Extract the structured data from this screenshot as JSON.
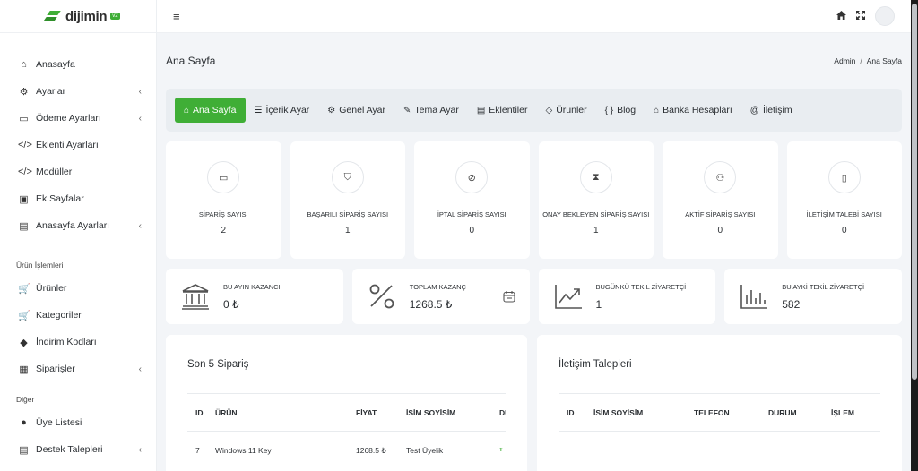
{
  "brand": {
    "name": "dijimin",
    "version": "v2",
    "accent": "#3fae36"
  },
  "sidebar": {
    "items": [
      {
        "label": "Anasayfa",
        "icon": "home-icon",
        "glyph": "⌂",
        "chevron": false
      },
      {
        "label": "Ayarlar",
        "icon": "cogs-icon",
        "glyph": "⚙",
        "chevron": true
      },
      {
        "label": "Ödeme Ayarları",
        "icon": "credit-card-icon",
        "glyph": "▭",
        "chevron": true
      },
      {
        "label": "Eklenti Ayarları",
        "icon": "code-icon",
        "glyph": "</>",
        "chevron": false
      },
      {
        "label": "Modüller",
        "icon": "code-icon",
        "glyph": "</>",
        "chevron": false
      },
      {
        "label": "Ek Sayfalar",
        "icon": "user-page-icon",
        "glyph": "▣",
        "chevron": false
      },
      {
        "label": "Anasayfa Ayarları",
        "icon": "id-card-icon",
        "glyph": "▤",
        "chevron": true
      }
    ],
    "section1": "Ürün İşlemleri",
    "items2": [
      {
        "label": "Ürünler",
        "icon": "cart-icon",
        "glyph": "🛒",
        "chevron": false
      },
      {
        "label": "Kategoriler",
        "icon": "cart-icon",
        "glyph": "🛒",
        "chevron": false
      },
      {
        "label": "İndirim Kodları",
        "icon": "tag-icon",
        "glyph": "◆",
        "chevron": false
      },
      {
        "label": "Siparişler",
        "icon": "briefcase-icon",
        "glyph": "▦",
        "chevron": true
      }
    ],
    "section2": "Diğer",
    "items3": [
      {
        "label": "Üye Listesi",
        "icon": "user-icon",
        "glyph": "●",
        "chevron": false
      },
      {
        "label": "Destek Talepleri",
        "icon": "id-card-icon",
        "glyph": "▤",
        "chevron": true
      }
    ]
  },
  "topbar": {
    "menu_glyph": "≡",
    "home_glyph": "⌂",
    "expand_glyph": "⤢"
  },
  "page": {
    "title": "Ana Sayfa",
    "breadcrumb": [
      "Admin",
      "Ana Sayfa"
    ]
  },
  "tabs": [
    {
      "label": "Ana Sayfa",
      "glyph": "⌂",
      "icon": "home-outline-icon",
      "active": true
    },
    {
      "label": "İçerik Ayar",
      "glyph": "☰",
      "icon": "list-icon",
      "active": false
    },
    {
      "label": "Genel Ayar",
      "glyph": "⚙",
      "icon": "gear-icon",
      "active": false
    },
    {
      "label": "Tema Ayar",
      "glyph": "✎",
      "icon": "magic-wand-icon",
      "active": false
    },
    {
      "label": "Eklentiler",
      "glyph": "▤",
      "icon": "layout-icon",
      "active": false
    },
    {
      "label": "Ürünler",
      "glyph": "◇",
      "icon": "tag-outline-icon",
      "active": false
    },
    {
      "label": "Blog",
      "glyph": "{ }",
      "icon": "braces-icon",
      "active": false
    },
    {
      "label": "Banka Hesapları",
      "glyph": "⌂",
      "icon": "bank-icon",
      "active": false
    },
    {
      "label": "İletişim",
      "glyph": "@",
      "icon": "at-icon",
      "active": false
    }
  ],
  "stats": [
    {
      "label": "SİPARİŞ SAYISI",
      "value": "2",
      "icon": "archive-icon",
      "glyph": "▭"
    },
    {
      "label": "BAŞARILI SİPARİŞ SAYISI",
      "value": "1",
      "icon": "shield-plus-icon",
      "glyph": "⛉"
    },
    {
      "label": "İPTAL SİPARİŞ SAYISI",
      "value": "0",
      "icon": "ban-icon",
      "glyph": "⊘"
    },
    {
      "label": "ONAY BEKLEYEN SİPARİŞ SAYISI",
      "value": "1",
      "icon": "hourglass-icon",
      "glyph": "⧗"
    },
    {
      "label": "AKTİF SİPARİŞ SAYISI",
      "value": "0",
      "icon": "user-clock-icon",
      "glyph": "⚇"
    },
    {
      "label": "İLETİŞİM TALEBİ SAYISI",
      "value": "0",
      "icon": "file-icon",
      "glyph": "▯"
    }
  ],
  "kpis": [
    {
      "label": "BU AYIN KAZANCI",
      "value": "0 ₺",
      "icon": "bank-icon"
    },
    {
      "label": "TOPLAM KAZANÇ",
      "value": "1268.5 ₺",
      "icon": "percent-icon"
    },
    {
      "label": "BUGÜNKÜ TEKİL ZİYARETÇİ",
      "value": "1",
      "icon": "trend-up-icon"
    },
    {
      "label": "BU AYKİ TEKİL ZİYARETÇİ",
      "value": "582",
      "icon": "bar-chart-icon"
    }
  ],
  "orders": {
    "title": "Son 5 Sipariş",
    "columns": [
      "ID",
      "ÜRÜN",
      "FİYAT",
      "İSİM SOYİSİM",
      "DU"
    ],
    "rows": [
      [
        "7",
        "Windows 11 Key",
        "1268.5 ₺",
        "Test Üyelik",
        "T"
      ]
    ]
  },
  "contacts": {
    "title": "İletişim Talepleri",
    "columns": [
      "ID",
      "İSİM SOYİSİM",
      "TELEFON",
      "DURUM",
      "İŞLEM"
    ]
  }
}
